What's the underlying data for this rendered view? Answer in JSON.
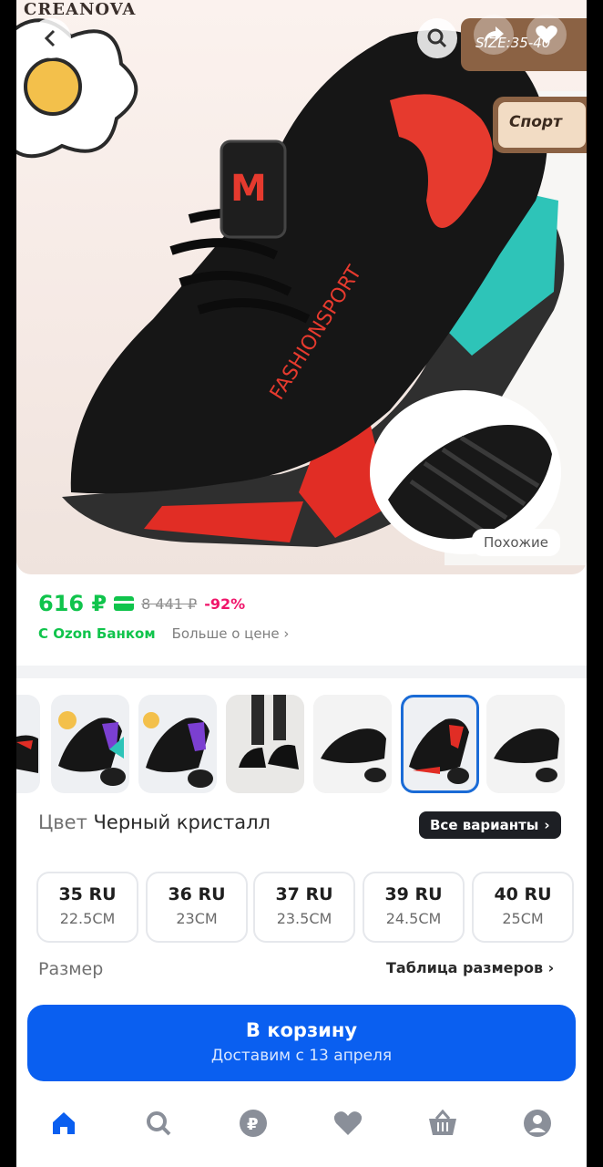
{
  "hero": {
    "brand_watermark": "CREANOVA",
    "size_tag": "SIZE:35-40",
    "sport_tag": "Спорт",
    "shoe_print": "FASHIONSPORT",
    "similar_label": "Похожие"
  },
  "price": {
    "current": "616 ₽",
    "old": "8 441 ₽",
    "discount": "-92%",
    "bank_label": "С Ozon Банком",
    "more_label": "Больше о цене"
  },
  "color": {
    "label": "Цвет",
    "value": "Черный кристалл",
    "all_variants": "Все варианты"
  },
  "sizes": [
    {
      "ru": "35 RU",
      "cm": "22.5CM"
    },
    {
      "ru": "36 RU",
      "cm": "23CM"
    },
    {
      "ru": "37 RU",
      "cm": "23.5CM"
    },
    {
      "ru": "39 RU",
      "cm": "24.5CM"
    },
    {
      "ru": "40 RU",
      "cm": "25CM"
    }
  ],
  "size_section": {
    "label": "Размер",
    "table_link": "Таблица размеров"
  },
  "cart": {
    "title": "В корзину",
    "subtitle": "Доставим с 13 апреля"
  },
  "colors": {
    "accent_blue": "#0a5ff0",
    "price_green": "#10c44c",
    "discount_pink": "#f0156a",
    "tag_brown": "#8b6244"
  },
  "nav": [
    "home-icon",
    "search-icon",
    "ruble-icon",
    "heart-icon",
    "basket-icon",
    "profile-icon"
  ]
}
